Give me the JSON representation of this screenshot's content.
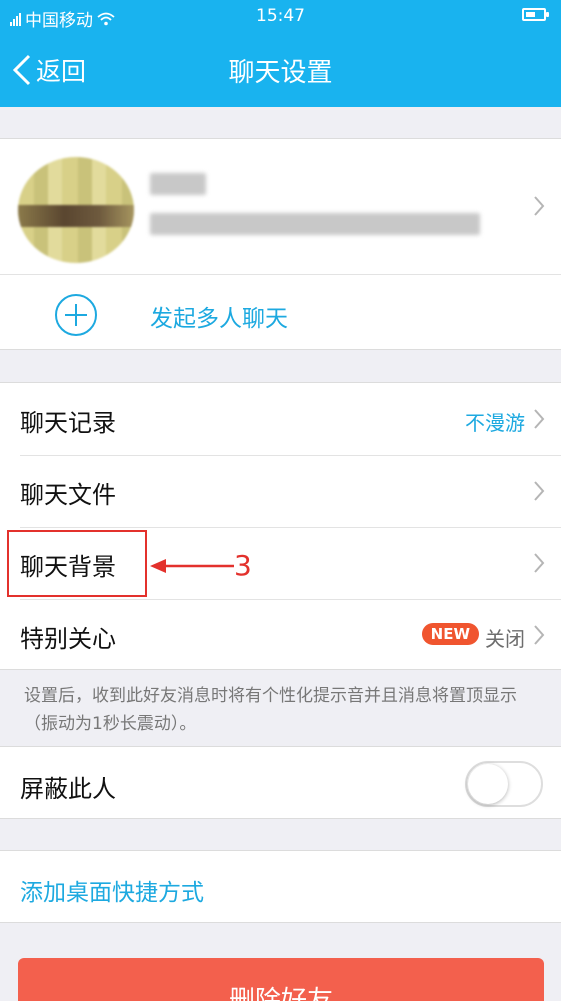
{
  "status": {
    "carrier": "中国移动",
    "time": "15:47"
  },
  "nav": {
    "back": "返回",
    "title": "聊天设置"
  },
  "group": {
    "label": "发起多人聊天"
  },
  "rows": [
    {
      "label": "聊天记录",
      "value": "不漫游"
    },
    {
      "label": "聊天文件",
      "value": ""
    },
    {
      "label": "聊天背景",
      "value": ""
    },
    {
      "label": "特别关心",
      "badge": "NEW",
      "value": "关闭"
    }
  ],
  "note": "设置后，收到此好友消息时将有个性化提示音并且消息将置顶显示（振动为1秒长震动）。",
  "block": {
    "label": "屏蔽此人",
    "enabled": false
  },
  "shortcut": {
    "label": "添加桌面快捷方式"
  },
  "delete_button": "删除好友",
  "annotation": {
    "number": "3"
  },
  "colors": {
    "header": "#19b3ef",
    "accent_link": "#1da9e0",
    "delete": "#f3604d",
    "annotation": "#e3312c",
    "badge": "#f0552f"
  }
}
